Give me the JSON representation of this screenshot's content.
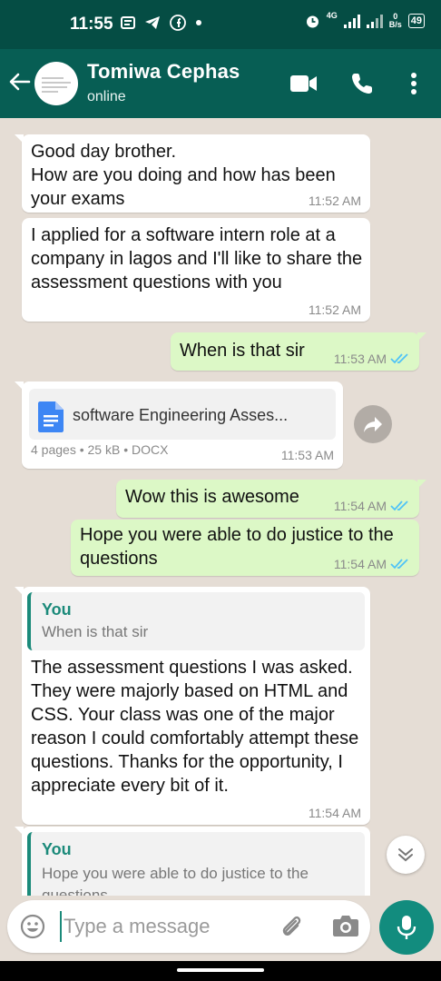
{
  "status_bar": {
    "time": "11:55",
    "network": "4G",
    "net_speed_value": "0",
    "net_speed_unit": "B/s",
    "battery": "49"
  },
  "header": {
    "contact_name": "Tomiwa Cephas",
    "contact_status": "online"
  },
  "messages": [
    {
      "direction": "in",
      "text": "Good day brother.\nHow are you doing and how has been your exams",
      "time": "11:52 AM"
    },
    {
      "direction": "in",
      "text": "I applied for a software intern role at a company in lagos and I'll like to share the assessment questions with you",
      "time": "11:52 AM"
    },
    {
      "direction": "out",
      "text": "When is that sir",
      "time": "11:53 AM"
    },
    {
      "direction": "in",
      "type": "document",
      "file_name": "software Engineering Asses...",
      "file_info": "4 pages • 25 kB • DOCX",
      "time": "11:53 AM"
    },
    {
      "direction": "out",
      "text": "Wow this is awesome",
      "time": "11:54 AM"
    },
    {
      "direction": "out",
      "text": "Hope you were able to do justice to the questions",
      "time": "11:54 AM"
    },
    {
      "direction": "in",
      "quote_author": "You",
      "quote_text": "When is that sir",
      "text": "The assessment questions I was asked. They were majorly based on HTML and CSS. Your class was one of the major reason I could comfortably attempt these questions. Thanks for the opportunity, I appreciate every bit of it.",
      "time": "11:54 AM"
    },
    {
      "direction": "in",
      "quote_author": "You",
      "quote_text": "Hope you were able to do justice to the questions"
    }
  ],
  "composer": {
    "placeholder": "Type a message"
  },
  "colors": {
    "header": "#075e54",
    "status_bar": "#054d44",
    "outgoing_bubble": "#dcf8c6",
    "incoming_bubble": "#ffffff",
    "accent": "#128c7e",
    "read_tick": "#4fc3f7"
  },
  "icons": [
    "back-arrow-icon",
    "video-call-icon",
    "voice-call-icon",
    "more-options-icon",
    "document-icon",
    "forward-icon",
    "scroll-down-icon",
    "emoji-icon",
    "attach-icon",
    "camera-icon",
    "mic-icon"
  ]
}
